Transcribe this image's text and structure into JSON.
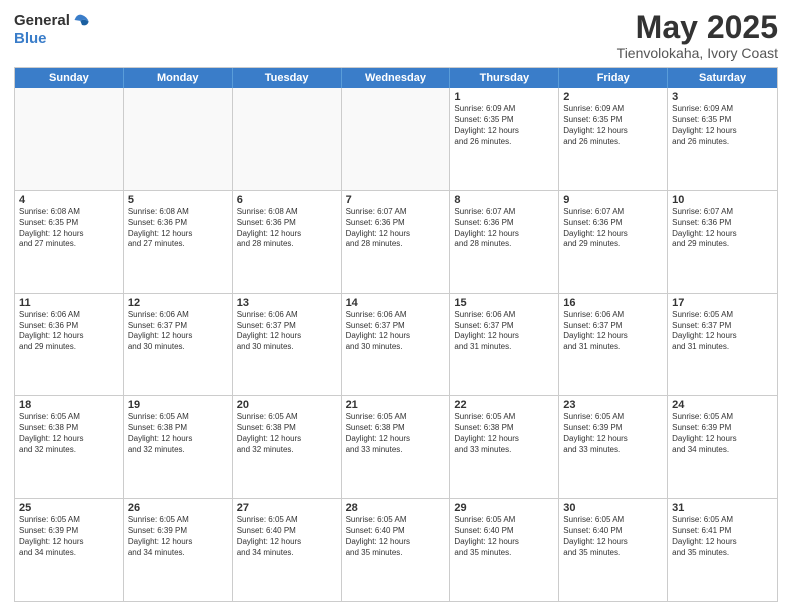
{
  "logo": {
    "general": "General",
    "blue": "Blue"
  },
  "title": "May 2025",
  "subtitle": "Tienvolokaha, Ivory Coast",
  "weekdays": [
    "Sunday",
    "Monday",
    "Tuesday",
    "Wednesday",
    "Thursday",
    "Friday",
    "Saturday"
  ],
  "weeks": [
    [
      {
        "day": "",
        "text": ""
      },
      {
        "day": "",
        "text": ""
      },
      {
        "day": "",
        "text": ""
      },
      {
        "day": "",
        "text": ""
      },
      {
        "day": "1",
        "text": "Sunrise: 6:09 AM\nSunset: 6:35 PM\nDaylight: 12 hours\nand 26 minutes."
      },
      {
        "day": "2",
        "text": "Sunrise: 6:09 AM\nSunset: 6:35 PM\nDaylight: 12 hours\nand 26 minutes."
      },
      {
        "day": "3",
        "text": "Sunrise: 6:09 AM\nSunset: 6:35 PM\nDaylight: 12 hours\nand 26 minutes."
      }
    ],
    [
      {
        "day": "4",
        "text": "Sunrise: 6:08 AM\nSunset: 6:35 PM\nDaylight: 12 hours\nand 27 minutes."
      },
      {
        "day": "5",
        "text": "Sunrise: 6:08 AM\nSunset: 6:36 PM\nDaylight: 12 hours\nand 27 minutes."
      },
      {
        "day": "6",
        "text": "Sunrise: 6:08 AM\nSunset: 6:36 PM\nDaylight: 12 hours\nand 28 minutes."
      },
      {
        "day": "7",
        "text": "Sunrise: 6:07 AM\nSunset: 6:36 PM\nDaylight: 12 hours\nand 28 minutes."
      },
      {
        "day": "8",
        "text": "Sunrise: 6:07 AM\nSunset: 6:36 PM\nDaylight: 12 hours\nand 28 minutes."
      },
      {
        "day": "9",
        "text": "Sunrise: 6:07 AM\nSunset: 6:36 PM\nDaylight: 12 hours\nand 29 minutes."
      },
      {
        "day": "10",
        "text": "Sunrise: 6:07 AM\nSunset: 6:36 PM\nDaylight: 12 hours\nand 29 minutes."
      }
    ],
    [
      {
        "day": "11",
        "text": "Sunrise: 6:06 AM\nSunset: 6:36 PM\nDaylight: 12 hours\nand 29 minutes."
      },
      {
        "day": "12",
        "text": "Sunrise: 6:06 AM\nSunset: 6:37 PM\nDaylight: 12 hours\nand 30 minutes."
      },
      {
        "day": "13",
        "text": "Sunrise: 6:06 AM\nSunset: 6:37 PM\nDaylight: 12 hours\nand 30 minutes."
      },
      {
        "day": "14",
        "text": "Sunrise: 6:06 AM\nSunset: 6:37 PM\nDaylight: 12 hours\nand 30 minutes."
      },
      {
        "day": "15",
        "text": "Sunrise: 6:06 AM\nSunset: 6:37 PM\nDaylight: 12 hours\nand 31 minutes."
      },
      {
        "day": "16",
        "text": "Sunrise: 6:06 AM\nSunset: 6:37 PM\nDaylight: 12 hours\nand 31 minutes."
      },
      {
        "day": "17",
        "text": "Sunrise: 6:05 AM\nSunset: 6:37 PM\nDaylight: 12 hours\nand 31 minutes."
      }
    ],
    [
      {
        "day": "18",
        "text": "Sunrise: 6:05 AM\nSunset: 6:38 PM\nDaylight: 12 hours\nand 32 minutes."
      },
      {
        "day": "19",
        "text": "Sunrise: 6:05 AM\nSunset: 6:38 PM\nDaylight: 12 hours\nand 32 minutes."
      },
      {
        "day": "20",
        "text": "Sunrise: 6:05 AM\nSunset: 6:38 PM\nDaylight: 12 hours\nand 32 minutes."
      },
      {
        "day": "21",
        "text": "Sunrise: 6:05 AM\nSunset: 6:38 PM\nDaylight: 12 hours\nand 33 minutes."
      },
      {
        "day": "22",
        "text": "Sunrise: 6:05 AM\nSunset: 6:38 PM\nDaylight: 12 hours\nand 33 minutes."
      },
      {
        "day": "23",
        "text": "Sunrise: 6:05 AM\nSunset: 6:39 PM\nDaylight: 12 hours\nand 33 minutes."
      },
      {
        "day": "24",
        "text": "Sunrise: 6:05 AM\nSunset: 6:39 PM\nDaylight: 12 hours\nand 34 minutes."
      }
    ],
    [
      {
        "day": "25",
        "text": "Sunrise: 6:05 AM\nSunset: 6:39 PM\nDaylight: 12 hours\nand 34 minutes."
      },
      {
        "day": "26",
        "text": "Sunrise: 6:05 AM\nSunset: 6:39 PM\nDaylight: 12 hours\nand 34 minutes."
      },
      {
        "day": "27",
        "text": "Sunrise: 6:05 AM\nSunset: 6:40 PM\nDaylight: 12 hours\nand 34 minutes."
      },
      {
        "day": "28",
        "text": "Sunrise: 6:05 AM\nSunset: 6:40 PM\nDaylight: 12 hours\nand 35 minutes."
      },
      {
        "day": "29",
        "text": "Sunrise: 6:05 AM\nSunset: 6:40 PM\nDaylight: 12 hours\nand 35 minutes."
      },
      {
        "day": "30",
        "text": "Sunrise: 6:05 AM\nSunset: 6:40 PM\nDaylight: 12 hours\nand 35 minutes."
      },
      {
        "day": "31",
        "text": "Sunrise: 6:05 AM\nSunset: 6:41 PM\nDaylight: 12 hours\nand 35 minutes."
      }
    ]
  ]
}
